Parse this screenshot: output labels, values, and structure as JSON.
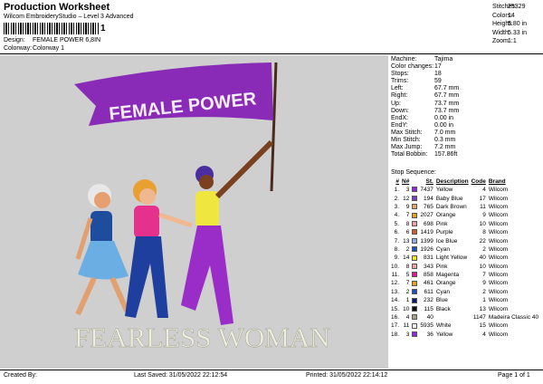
{
  "header": {
    "title": "Production Worksheet",
    "subtitle": "Wilcom EmbroideryStudio – Level 3 Advanced",
    "barcode_mark": "1",
    "design_label": "Design:",
    "design_value": "FEMALE POWER 6,8IN",
    "colorway_label": "Colorway:",
    "colorway_value": "Colorway 1"
  },
  "stats": [
    {
      "label": "Stitches:",
      "value": "25329"
    },
    {
      "label": "Colors:",
      "value": "14"
    },
    {
      "label": "Height:",
      "value": "5.80 in"
    },
    {
      "label": "Width:",
      "value": "5.33 in"
    },
    {
      "label": "Zoom:",
      "value": "1:1"
    }
  ],
  "artwork": {
    "banner_text": "FEMALE POWER",
    "bottom_text": "FEARLESS WOMAN"
  },
  "machine": [
    {
      "label": "Machine:",
      "value": "Tajima"
    },
    {
      "label": "Color changes:",
      "value": "17"
    },
    {
      "label": "Stops:",
      "value": "18"
    },
    {
      "label": "Trims:",
      "value": "59"
    },
    {
      "label": "Left:",
      "value": "67.7 mm"
    },
    {
      "label": "Right:",
      "value": "67.7 mm"
    },
    {
      "label": "Up:",
      "value": "73.7 mm"
    },
    {
      "label": "Down:",
      "value": "73.7 mm"
    },
    {
      "label": "EndX:",
      "value": "0.00 in"
    },
    {
      "label": "EndY:",
      "value": "0.00 in"
    },
    {
      "label": "Max Stitch:",
      "value": "7.0 mm"
    },
    {
      "label": "Min Stitch:",
      "value": "0.3 mm"
    },
    {
      "label": "Max Jump:",
      "value": "7.2 mm"
    },
    {
      "label": "Total Bobbin:",
      "value": "157.86ft"
    }
  ],
  "stop_sequence": {
    "heading": "Stop Sequence:",
    "columns": [
      "#",
      "N#",
      "St.",
      "Description",
      "Code",
      "Brand"
    ],
    "rows": [
      {
        "n": "1.",
        "idx": "3",
        "color": "#8a2be2",
        "st": "7437",
        "desc": "Yellow",
        "code": "4",
        "brand": "Wilcom"
      },
      {
        "n": "2.",
        "idx": "12",
        "color": "#7b3fc6",
        "st": "194",
        "desc": "Baby Blue",
        "code": "17",
        "brand": "Wilcom"
      },
      {
        "n": "3.",
        "idx": "9",
        "color": "#e2a86b",
        "st": "765",
        "desc": "Dark Brown",
        "code": "11",
        "brand": "Wilcom"
      },
      {
        "n": "4.",
        "idx": "7",
        "color": "#e8a020",
        "st": "2027",
        "desc": "Orange",
        "code": "9",
        "brand": "Wilcom"
      },
      {
        "n": "5.",
        "idx": "8",
        "color": "#f0a0a8",
        "st": "698",
        "desc": "Pink",
        "code": "10",
        "brand": "Wilcom"
      },
      {
        "n": "6.",
        "idx": "6",
        "color": "#c86030",
        "st": "1419",
        "desc": "Purple",
        "code": "8",
        "brand": "Wilcom"
      },
      {
        "n": "7.",
        "idx": "13",
        "color": "#8ab0e0",
        "st": "1399",
        "desc": "Ice Blue",
        "code": "22",
        "brand": "Wilcom"
      },
      {
        "n": "8.",
        "idx": "2",
        "color": "#2050c0",
        "st": "1926",
        "desc": "Cyan",
        "code": "2",
        "brand": "Wilcom"
      },
      {
        "n": "9.",
        "idx": "14",
        "color": "#f0e820",
        "st": "831",
        "desc": "Light Yellow",
        "code": "40",
        "brand": "Wilcom"
      },
      {
        "n": "10.",
        "idx": "8",
        "color": "#f0a0a8",
        "st": "343",
        "desc": "Pink",
        "code": "10",
        "brand": "Wilcom"
      },
      {
        "n": "11.",
        "idx": "5",
        "color": "#e01890",
        "st": "858",
        "desc": "Magenta",
        "code": "7",
        "brand": "Wilcom"
      },
      {
        "n": "12.",
        "idx": "7",
        "color": "#e8a020",
        "st": "461",
        "desc": "Orange",
        "code": "9",
        "brand": "Wilcom"
      },
      {
        "n": "13.",
        "idx": "2",
        "color": "#2050c0",
        "st": "611",
        "desc": "Cyan",
        "code": "2",
        "brand": "Wilcom"
      },
      {
        "n": "14.",
        "idx": "1",
        "color": "#101880",
        "st": "232",
        "desc": "Blue",
        "code": "1",
        "brand": "Wilcom"
      },
      {
        "n": "15.",
        "idx": "10",
        "color": "#111111",
        "st": "115",
        "desc": "Black",
        "code": "13",
        "brand": "Wilcom"
      },
      {
        "n": "16.",
        "idx": "4",
        "color": "#a8a090",
        "st": "40",
        "desc": "",
        "code": "1147",
        "brand": "Madeira Classic 40"
      },
      {
        "n": "17.",
        "idx": "11",
        "color": "#ffffff",
        "st": "5935",
        "desc": "White",
        "code": "15",
        "brand": "Wilcom"
      },
      {
        "n": "18.",
        "idx": "3",
        "color": "#8a2be2",
        "st": "36",
        "desc": "Yellow",
        "code": "4",
        "brand": "Wilcom"
      }
    ]
  },
  "footer": {
    "created": "Created By:",
    "saved": "Last Saved: 31/05/2022 22:12:54",
    "printed": "Printed: 31/05/2022 22:14:12",
    "page": "Page 1 of 1"
  }
}
